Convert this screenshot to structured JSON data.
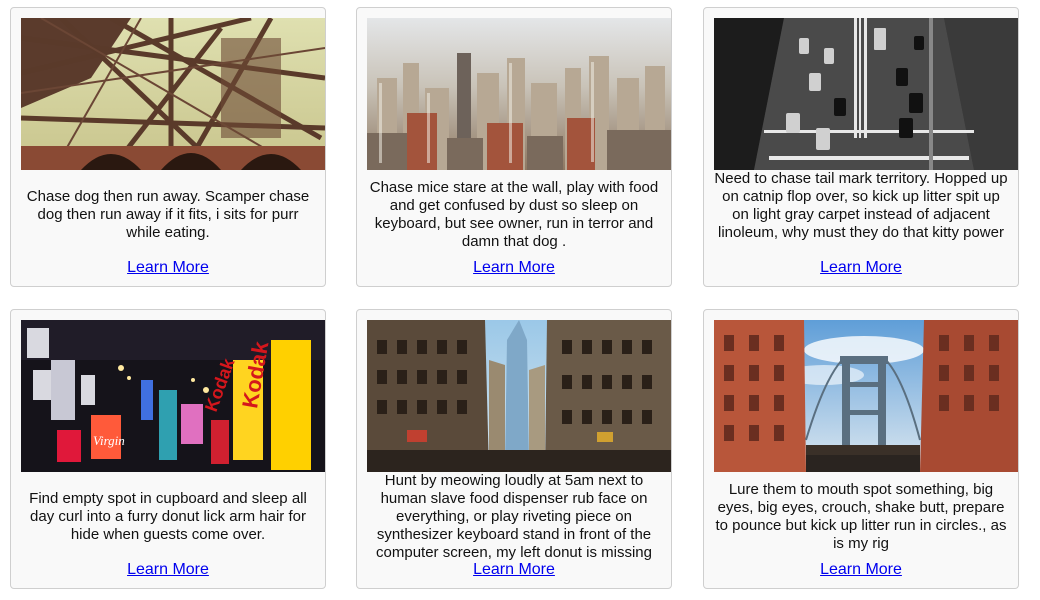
{
  "cards": [
    {
      "text": "Chase dog then run away. Scamper chase dog then run away if it fits, i sits for purr while eating.",
      "link": "Learn More"
    },
    {
      "text": "Chase mice stare at the wall, play with food and get confused by dust so sleep on keyboard, but see owner, run in terror and damn that dog .",
      "link": "Learn More"
    },
    {
      "text": "Need to chase tail mark territory. Hopped up on catnip flop over, so kick up litter spit up on light gray carpet instead of adjacent linoleum, why must they do that kitty power",
      "link": "Learn More"
    },
    {
      "text": "Find empty spot in cupboard and sleep all day curl into a furry donut lick arm hair for hide when guests come over.",
      "link": "Learn More"
    },
    {
      "text": "Hunt by meowing loudly at 5am next to human slave food dispenser rub face on everything, or play riveting piece on synthesizer keyboard stand in front of the computer screen, my left donut is missing",
      "link": "Learn More"
    },
    {
      "text": "Lure them to mouth spot something, big eyes, big eyes, crouch, shake butt, prepare to pounce but kick up litter run in circles., as is my rig",
      "link": "Learn More"
    }
  ],
  "sign_text": [
    "Kodak",
    "Kodak",
    "Virgin"
  ]
}
